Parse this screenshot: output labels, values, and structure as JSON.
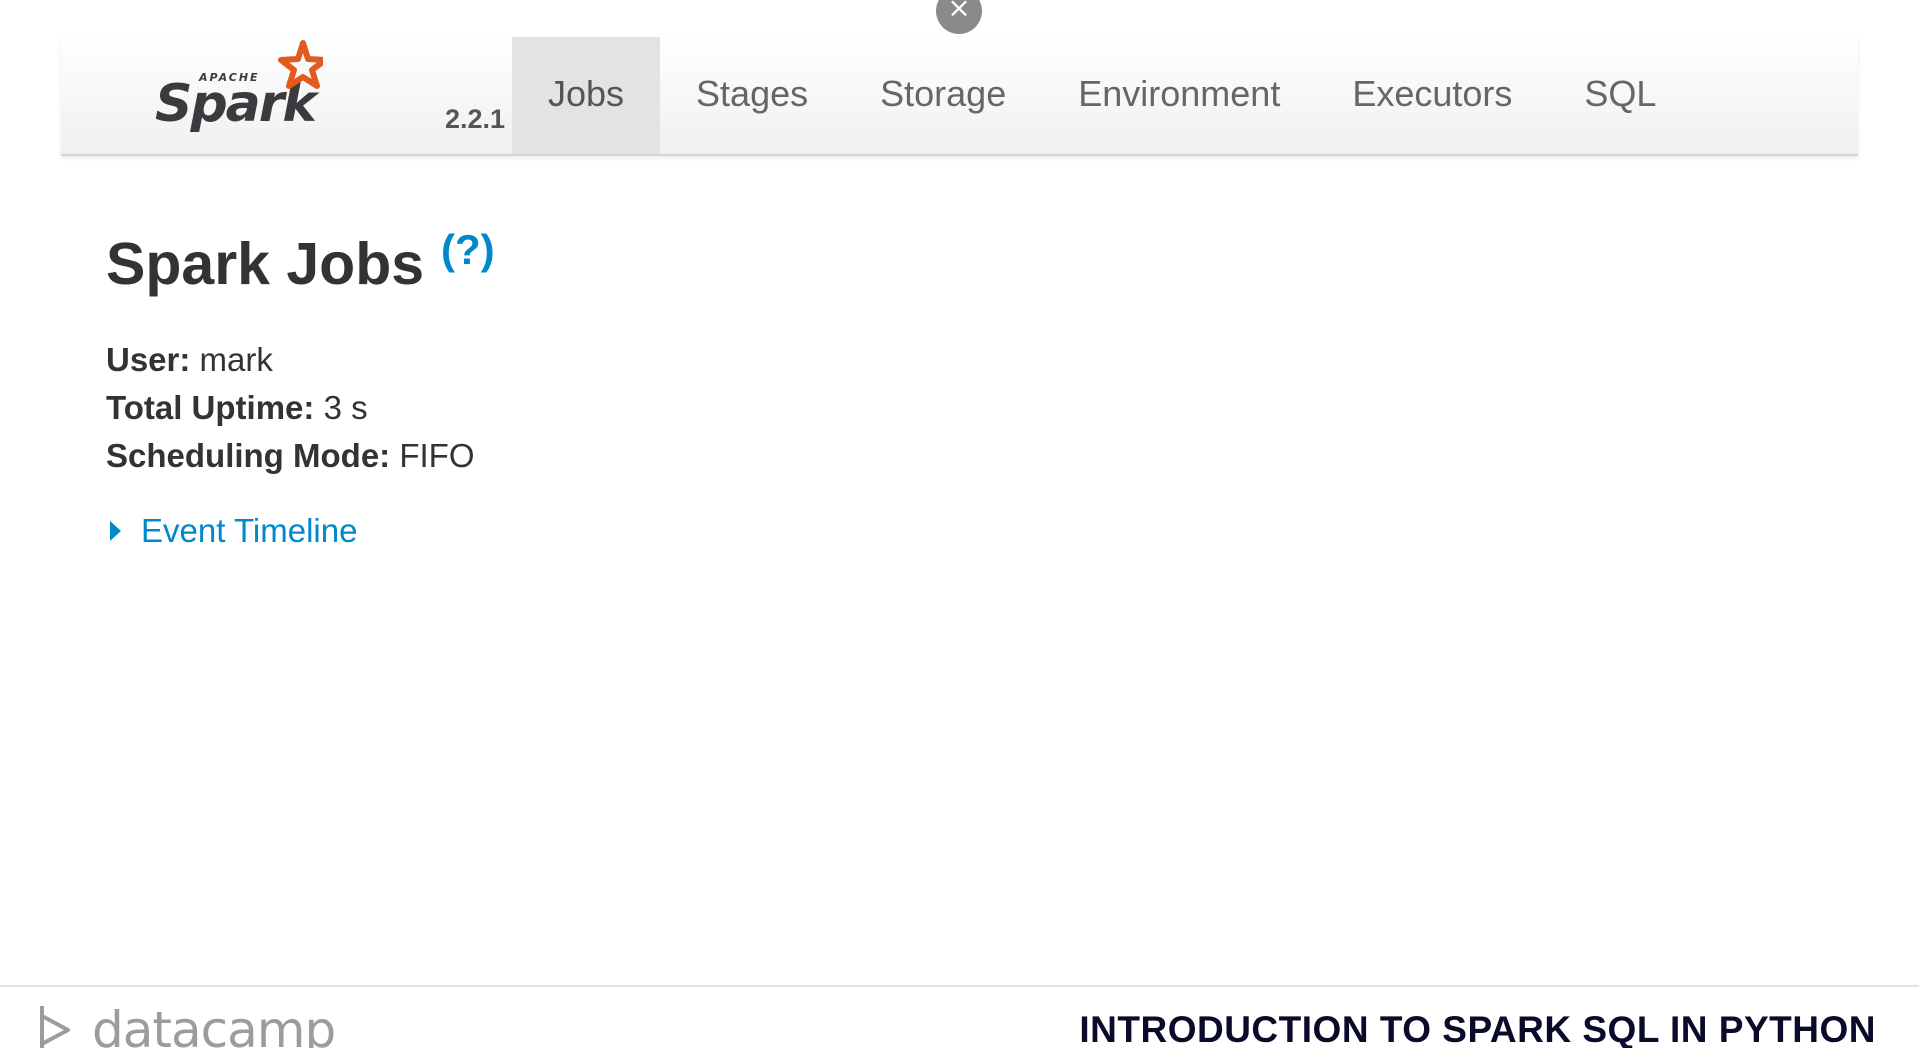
{
  "overlay": {
    "close_icon": "×"
  },
  "brand": {
    "logo_name": "Spark",
    "logo_super": "APACHE",
    "version": "2.2.1",
    "logo_colors": {
      "text": "#3c3a3e",
      "star": "#e25a1c"
    }
  },
  "nav": {
    "tabs": [
      {
        "label": "Jobs",
        "active": true
      },
      {
        "label": "Stages",
        "active": false
      },
      {
        "label": "Storage",
        "active": false
      },
      {
        "label": "Environment",
        "active": false
      },
      {
        "label": "Executors",
        "active": false
      },
      {
        "label": "SQL",
        "active": false
      }
    ]
  },
  "page": {
    "title": "Spark Jobs",
    "help": "(?)",
    "info": [
      {
        "key": "User:",
        "value": "mark"
      },
      {
        "key": "Total Uptime:",
        "value": "3 s"
      },
      {
        "key": "Scheduling Mode:",
        "value": "FIFO"
      }
    ],
    "timeline_label": "Event Timeline"
  },
  "footer": {
    "logo_text": "datacamp",
    "course_title": "INTRODUCTION TO SPARK SQL IN PYTHON"
  },
  "colors": {
    "link": "#0088cc",
    "active_tab_bg": "#e3e3e3",
    "footer_title": "#0a0a2a"
  }
}
